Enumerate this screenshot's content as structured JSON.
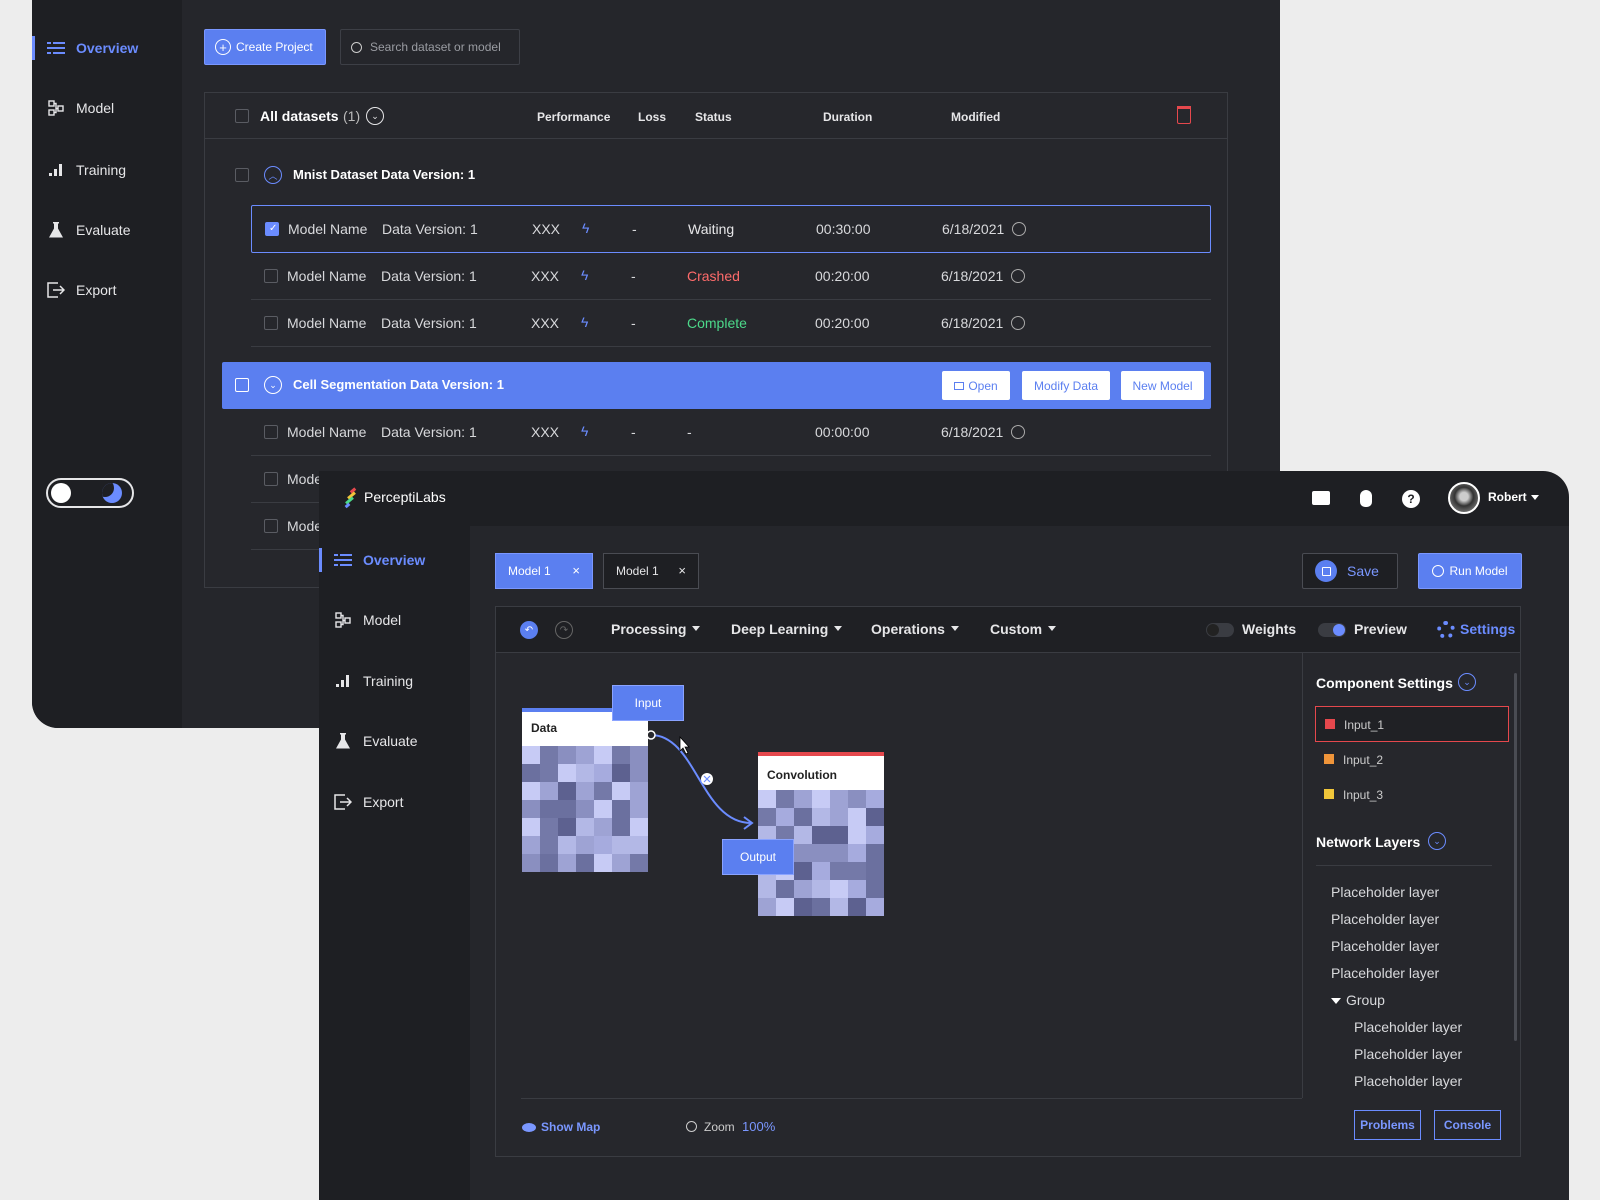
{
  "back": {
    "nav": [
      {
        "label": "Overview",
        "icon": "overview-icon",
        "active": true
      },
      {
        "label": "Model",
        "icon": "model-icon"
      },
      {
        "label": "Training",
        "icon": "training-icon"
      },
      {
        "label": "Evaluate",
        "icon": "flask-icon"
      },
      {
        "label": "Export",
        "icon": "export-icon"
      }
    ],
    "create_project": "Create Project",
    "search_placeholder": "Search dataset or model",
    "table": {
      "all_datasets": "All datasets",
      "count": "(1)",
      "headers": [
        "Performance",
        "Loss",
        "Status",
        "Duration",
        "Modified"
      ]
    },
    "group1": {
      "title": "Mnist Dataset Data Version: 1",
      "rows": [
        {
          "name": "Model Name",
          "version": "Data Version: 1",
          "perf": "XXX",
          "loss": "-",
          "status": "Waiting",
          "status_color": "#e6e6e8",
          "duration": "00:30:00",
          "modified": "6/18/2021"
        },
        {
          "name": "Model Name",
          "version": "Data Version: 1",
          "perf": "XXX",
          "loss": "-",
          "status": "Crashed",
          "status_color": "#ff6b6b",
          "duration": "00:20:00",
          "modified": "6/18/2021"
        },
        {
          "name": "Model Name",
          "version": "Data Version: 1",
          "perf": "XXX",
          "loss": "-",
          "status": "Complete",
          "status_color": "#4cd98a",
          "duration": "00:20:00",
          "modified": "6/18/2021"
        }
      ]
    },
    "group2": {
      "title": "Cell Segmentation Data Version: 1",
      "open": "Open",
      "modify": "Modify Data",
      "new_model": "New Model",
      "rows": [
        {
          "name": "Model Name",
          "version": "Data Version: 1",
          "perf": "XXX",
          "loss": "-",
          "status": "-",
          "duration": "00:00:00",
          "modified": "6/18/2021"
        }
      ],
      "partial_rows": [
        "Mode",
        "Mode"
      ]
    }
  },
  "front": {
    "app_name": "PerceptiLabs",
    "user": "Robert",
    "nav": [
      {
        "label": "Overview",
        "active": true
      },
      {
        "label": "Model"
      },
      {
        "label": "Training"
      },
      {
        "label": "Evaluate"
      },
      {
        "label": "Export"
      }
    ],
    "tabs": [
      {
        "label": "Model 1",
        "active": true
      },
      {
        "label": "Model 1",
        "active": false
      }
    ],
    "save": "Save",
    "run_model": "Run Model",
    "menus": [
      "Processing",
      "Deep Learning",
      "Operations",
      "Custom"
    ],
    "weights": "Weights",
    "preview": "Preview",
    "settings": "Settings",
    "canvas": {
      "data_node": "Data",
      "input_tag": "Input",
      "conv_node": "Convolution",
      "output_tag": "Output"
    },
    "component_settings": "Component Settings",
    "inputs": [
      {
        "label": "Input_1",
        "color": "#e5484d"
      },
      {
        "label": "Input_2",
        "color": "#f0953a"
      },
      {
        "label": "Input_3",
        "color": "#f0c63a"
      }
    ],
    "network_layers": "Network Layers",
    "layers": [
      "Placeholder layer",
      "Placeholder layer",
      "Placeholder layer",
      "Placeholder layer"
    ],
    "group": "Group",
    "group_layers": [
      "Placeholder layer",
      "Placeholder layer",
      "Placeholder layer"
    ],
    "show_map": "Show Map",
    "zoom_label": "Zoom",
    "zoom_value": "100%",
    "problems": "Problems",
    "console": "Console"
  }
}
